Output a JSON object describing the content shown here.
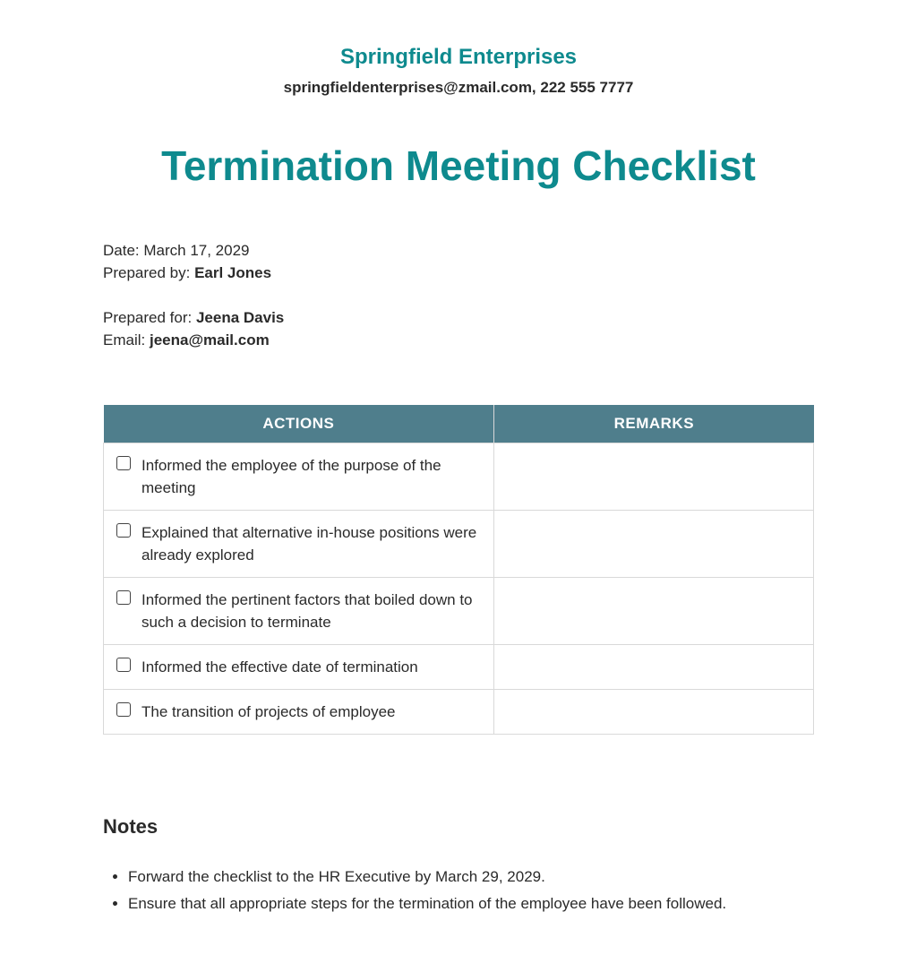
{
  "header": {
    "company_name": "Springfield Enterprises",
    "contact": "springfieldenterprises@zmail.com, 222 555 7777"
  },
  "title": "Termination Meeting Checklist",
  "meta": {
    "date_label": "Date: ",
    "date_value": "March 17, 2029",
    "prepared_by_label": "Prepared by: ",
    "prepared_by_value": "Earl Jones",
    "prepared_for_label": "Prepared for: ",
    "prepared_for_value": "Jeena Davis",
    "email_label": "Email: ",
    "email_value": "jeena@mail.com"
  },
  "table": {
    "col_actions": "ACTIONS",
    "col_remarks": "REMARKS",
    "rows": [
      {
        "action": "Informed the employee of the purpose of the meeting",
        "remarks": ""
      },
      {
        "action": "Explained that alternative in-house positions were already explored",
        "remarks": ""
      },
      {
        "action": "Informed the pertinent factors that boiled down to such a decision to terminate",
        "remarks": ""
      },
      {
        "action": "Informed the effective date of termination",
        "remarks": ""
      },
      {
        "action": "The transition of projects of employee",
        "remarks": ""
      }
    ]
  },
  "notes": {
    "heading": "Notes",
    "items": [
      "Forward the checklist to the HR Executive by March  29, 2029.",
      "Ensure that all appropriate steps for the termination of the employee have been followed."
    ]
  }
}
